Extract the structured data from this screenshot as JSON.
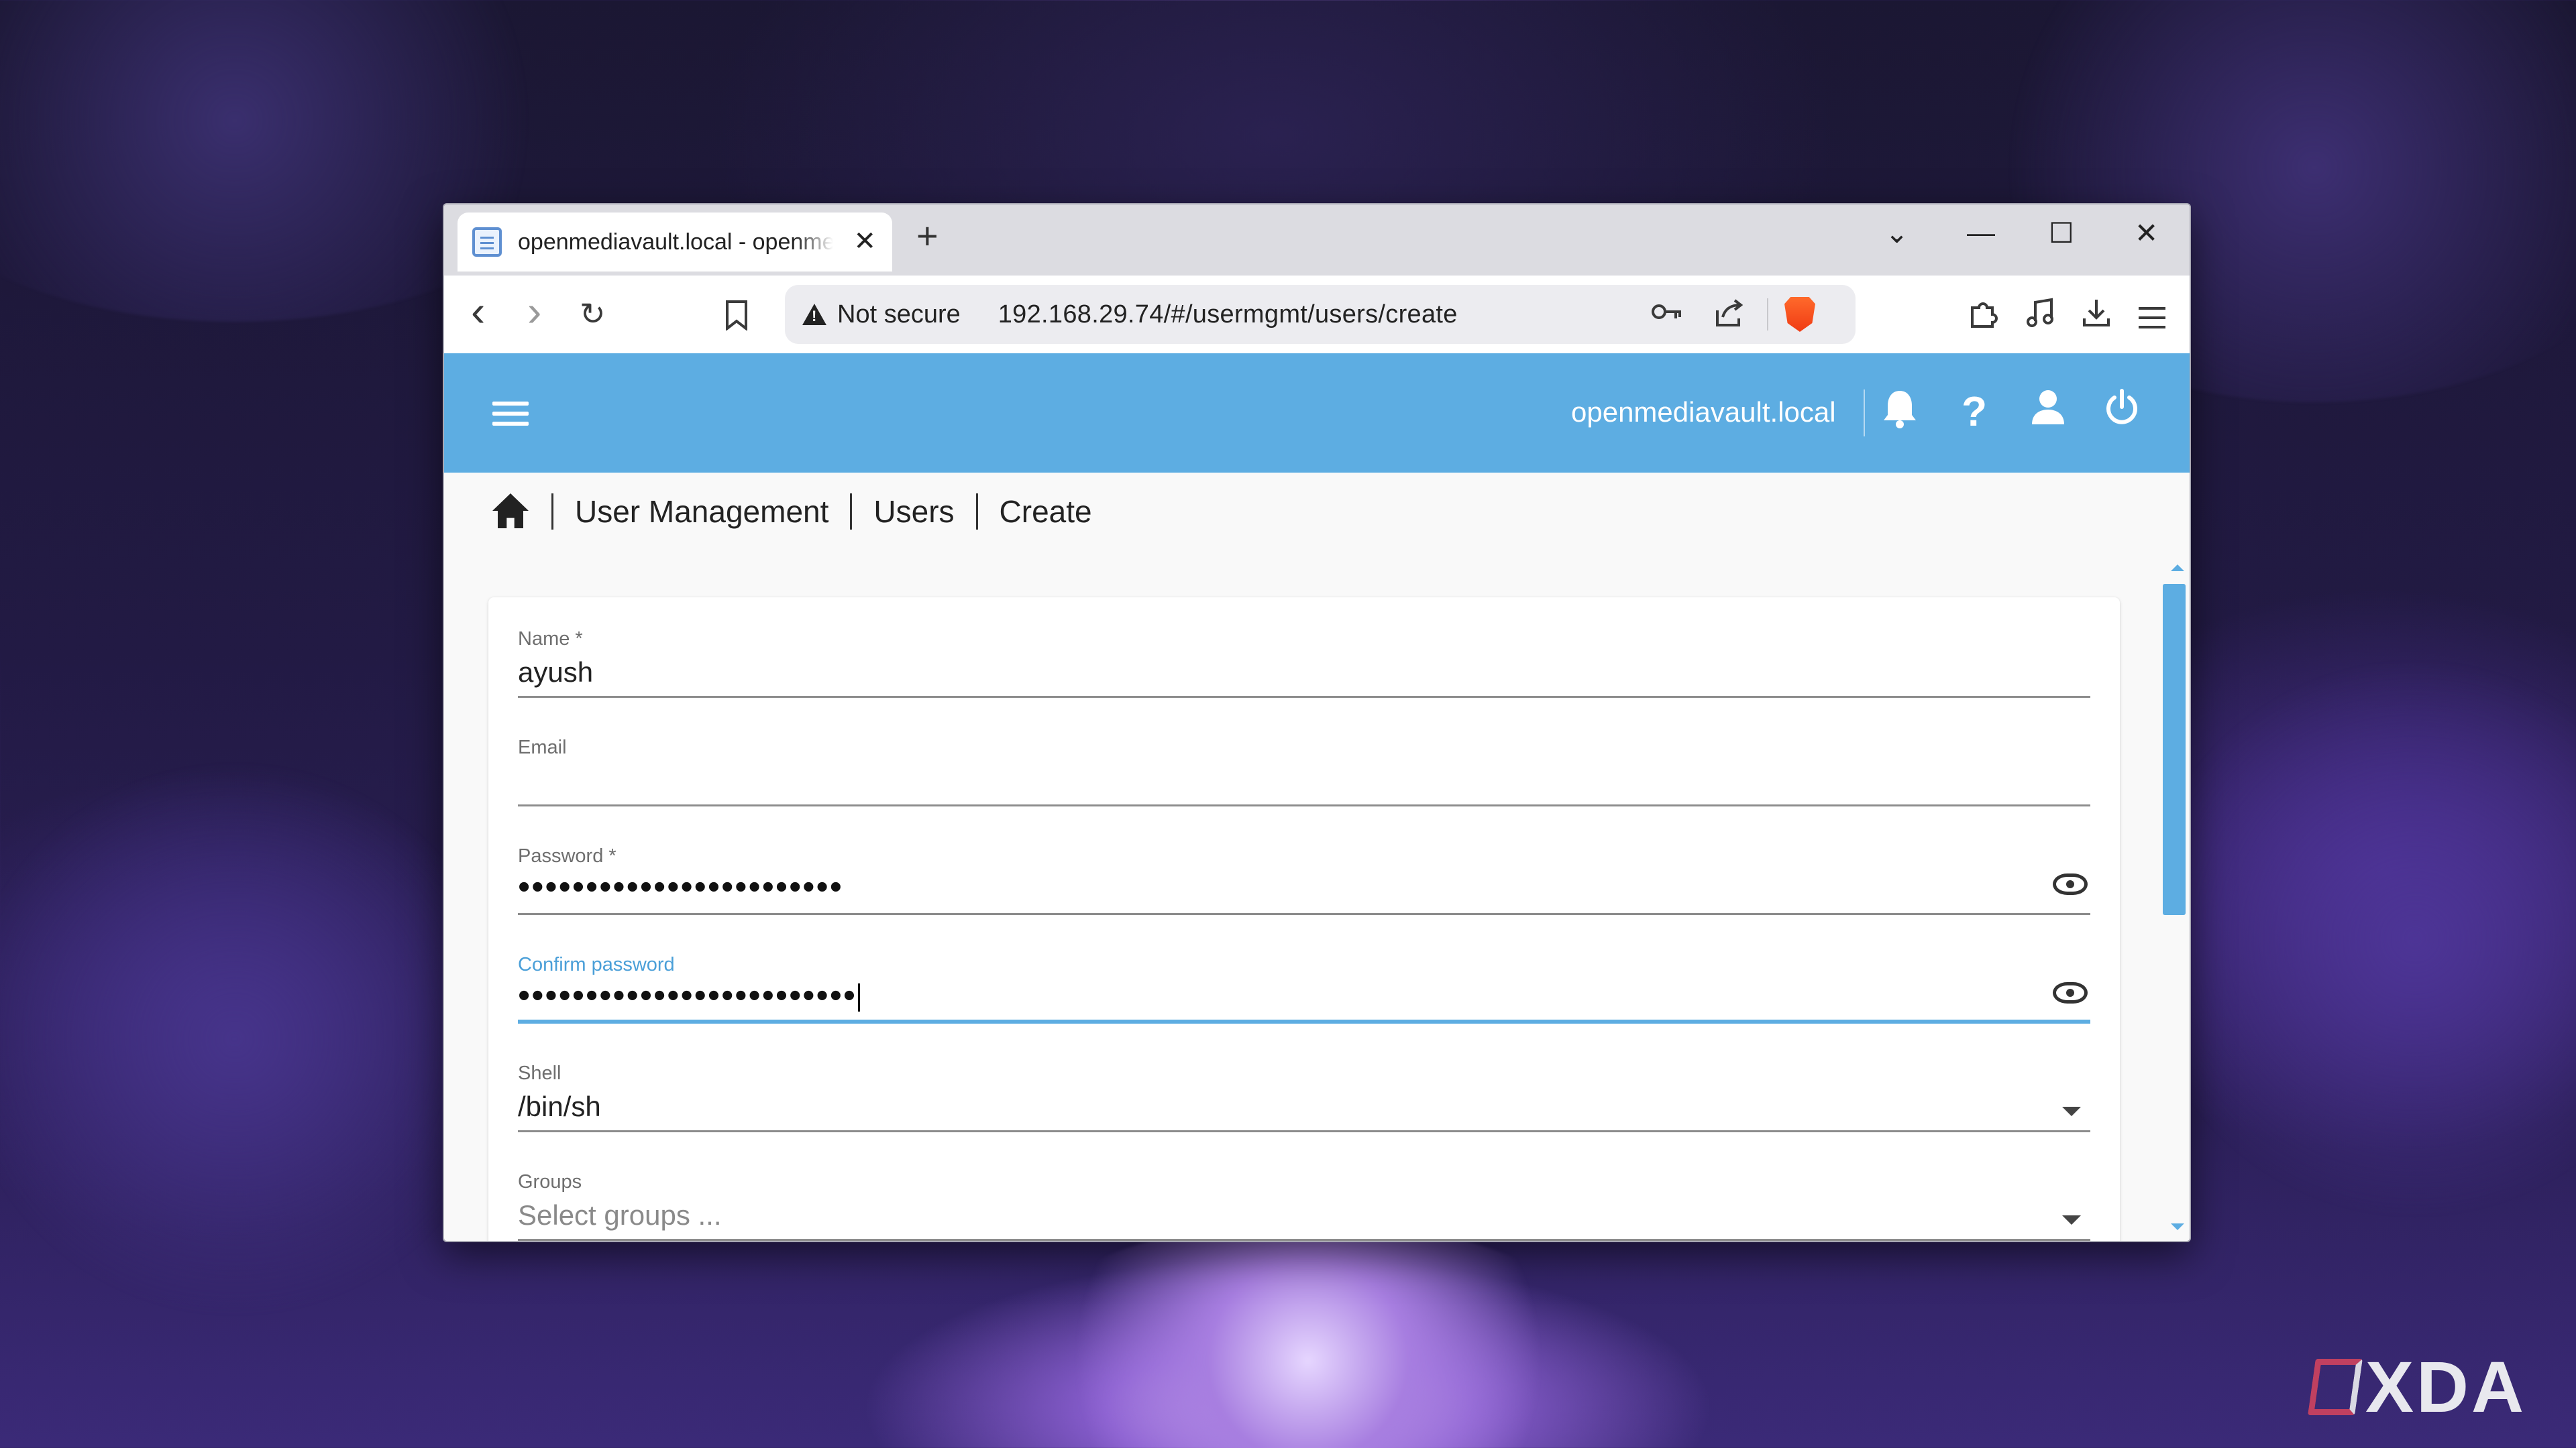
{
  "browser": {
    "tab": {
      "title": "openmediavault.local - openmediavault",
      "close": "✕"
    },
    "new_tab": "+",
    "window_controls": {
      "list": "⌄",
      "minimize": "—",
      "maximize": "☐",
      "close": "✕"
    },
    "nav": {
      "back": "‹",
      "forward": "›",
      "reload": "↻",
      "bookmark": "🔖"
    },
    "omnibox": {
      "security_label": "Not secure",
      "url": "192.168.29.74/#/usermgmt/users/create",
      "password_key_icon": "key-icon",
      "share_icon": "share-icon"
    },
    "toolbar_icons": [
      "extensions-icon",
      "media-icon",
      "download-icon",
      "menu-icon"
    ]
  },
  "app": {
    "header": {
      "menu_icon": "hamburger-icon",
      "hostname": "openmediavault.local",
      "icons": {
        "notifications": "🔔",
        "help": "?",
        "user": "👤",
        "power": "⏻"
      }
    },
    "breadcrumb": {
      "home_icon": "home-icon",
      "items": [
        "User Management",
        "Users",
        "Create"
      ]
    },
    "form": {
      "name": {
        "label": "Name *",
        "value": "ayush"
      },
      "email": {
        "label": "Email",
        "value": ""
      },
      "password": {
        "label": "Password *",
        "masked": "••••••••••••••••••••••••"
      },
      "confirm_password": {
        "label": "Confirm password",
        "masked": "•••••••••••••••••••••••••"
      },
      "shell": {
        "label": "Shell",
        "value": "/bin/sh"
      },
      "groups": {
        "label": "Groups",
        "placeholder": "Select groups ..."
      }
    },
    "accent_color": "#5dade2"
  },
  "watermark": {
    "text": "XDA"
  }
}
